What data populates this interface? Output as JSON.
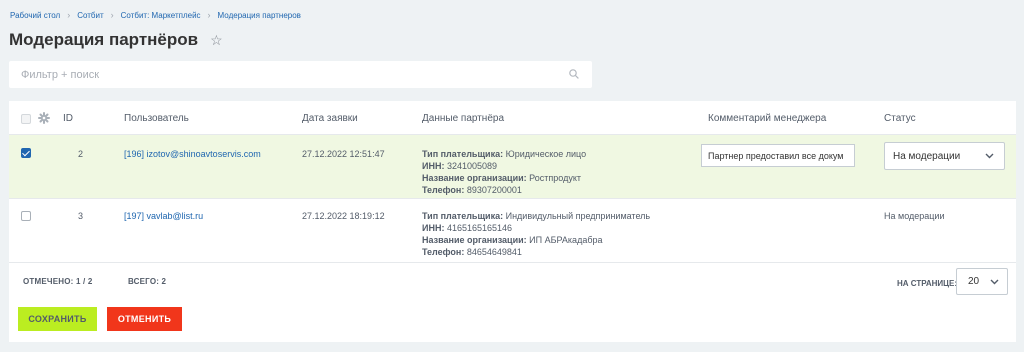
{
  "breadcrumbs": [
    "Рабочий стол",
    "Сотбит",
    "Сотбит: Маркетплейс",
    "Модерация партнеров"
  ],
  "page": {
    "title": "Модерация партнёров"
  },
  "filter": {
    "placeholder": "Фильтр + поиск"
  },
  "columns": {
    "id": "ID",
    "user": "Пользователь",
    "date": "Дата заявки",
    "partner": "Данные партнёра",
    "comment": "Комментарий менеджера",
    "status": "Статус"
  },
  "partner_labels": {
    "payer_type": "Тип плательщика:",
    "inn": "ИНН:",
    "org_name": "Название организации:",
    "phone": "Телефон:"
  },
  "rows": [
    {
      "checked": true,
      "id": "2",
      "user": "[196] izotov@shinoavtoservis.com",
      "date": "27.12.2022 12:51:47",
      "payer_type": "Юридическое лицо",
      "inn": "3241005089",
      "org_name": "Ростпродукт",
      "phone": "89307200001",
      "comment": "Партнер предоставил все докум",
      "status": "На модерации"
    },
    {
      "checked": false,
      "id": "3",
      "user": "[197] vavlab@list.ru",
      "date": "27.12.2022 18:19:12",
      "payer_type": "Индивидульный предприниматель",
      "inn": "4165165165146",
      "org_name": "ИП АБРАкадабра",
      "phone": "84654649841",
      "comment": "",
      "status": "На модерации"
    }
  ],
  "footer": {
    "selected": "ОТМЕЧЕНО: 1 / 2",
    "total": "ВСЕГО: 2",
    "per_page_label": "НА СТРАНИЦЕ:",
    "per_page_value": "20"
  },
  "actions": {
    "save": "СОХРАНИТЬ",
    "cancel": "ОТМЕНИТЬ"
  },
  "colors": {
    "accent": "#2067b0",
    "save": "#bbed21",
    "cancel": "#f1361b",
    "selected_row": "#f0f8e2"
  }
}
